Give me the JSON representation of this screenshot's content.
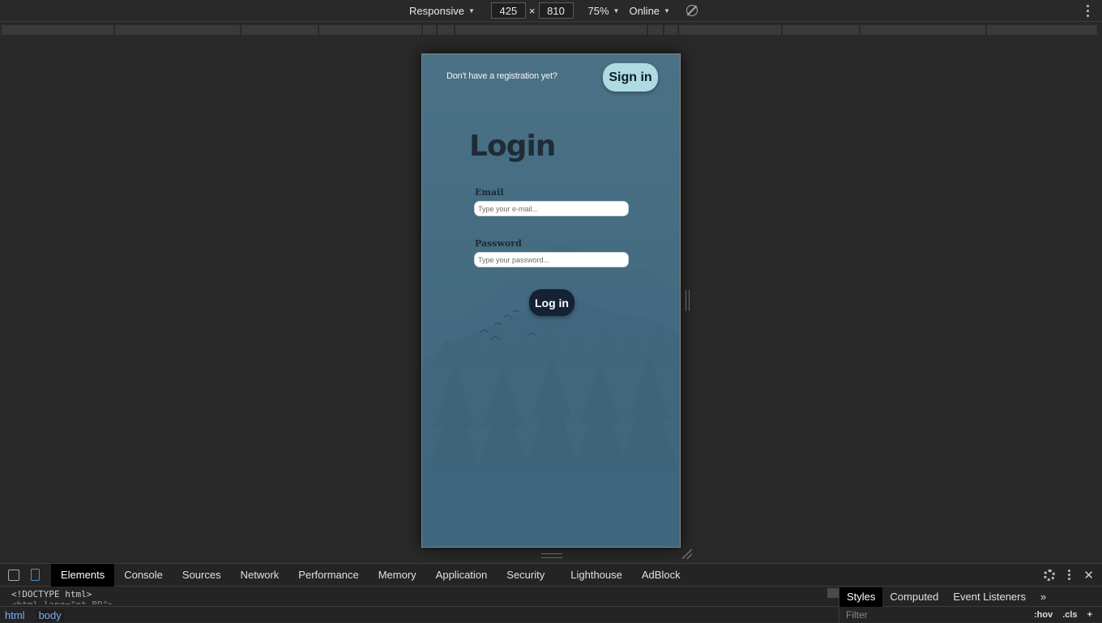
{
  "device_toolbar": {
    "device": "Responsive",
    "width": "425",
    "height": "810",
    "times": "×",
    "zoom": "75%",
    "network": "Online"
  },
  "page": {
    "header_text": "Don't have a registration yet?",
    "signin_label": "Sign in",
    "title": "Login",
    "email_label": "Email",
    "email_placeholder": "Type your e-mail...",
    "password_label": "Password",
    "password_placeholder": "Type your password...",
    "login_label": "Log in"
  },
  "colors": {
    "page_bg": "#446b80",
    "signin_bg": "#aedbe2",
    "login_bg": "#142234",
    "title": "#1f2c36"
  },
  "devtools": {
    "tabs": [
      "Elements",
      "Console",
      "Sources",
      "Network",
      "Performance",
      "Memory",
      "Application",
      "Security",
      "Lighthouse",
      "AdBlock"
    ],
    "code_line1": "<!DOCTYPE html>",
    "code_line2": "<html lang=\"pt-BR\">",
    "breadcrumb": [
      "html",
      "body"
    ],
    "styles_tabs": [
      "Styles",
      "Computed",
      "Event Listeners"
    ],
    "more_tabs": "»",
    "filter_placeholder": "Filter",
    "hov": ":hov",
    "cls": ".cls",
    "plus": "+"
  }
}
